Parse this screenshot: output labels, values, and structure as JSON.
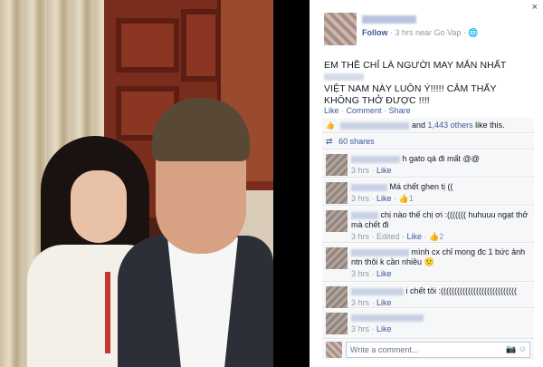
{
  "post": {
    "meta_follow": "Follow",
    "meta_time": " · 3 hrs near Go Vap · ",
    "privacy_icon": "globe-icon",
    "text_line1": "EM THỀ CHỈ LÀ NGƯỜI MAY MẮN NHẤT",
    "text_line2": "VIỆT NAM NÀY LUÔN Ý!!!!! CẢM THẤY KHÔNG THỞ ĐƯỢC !!!!",
    "actions": {
      "like": "Like",
      "comment": "Comment",
      "share": "Share"
    },
    "likes_text_and": "and",
    "likes_others": "1,443 others",
    "likes_suffix": "like this.",
    "shares_count": "60 shares",
    "close": "×"
  },
  "comments": [
    {
      "text": "h gato qá đi mất @@",
      "meta": "3 hrs · ",
      "like": "Like",
      "likes_count": ""
    },
    {
      "text": "Má chết          ghen tị       ((",
      "meta": "3 hrs · ",
      "like": "Like",
      "likes_count": "1"
    },
    {
      "text": "chị nào thế chị ơi :((((((( huhuuu          ngạt thở mà chết đi",
      "meta": "3 hrs · Edited · ",
      "like": "Like",
      "likes_count": "2"
    },
    {
      "text": "mình cx chỉ mong đc 1 bức ảnh ntn thôi k cần nhiều 🙁",
      "meta": "3 hrs · ",
      "like": "Like",
      "likes_count": ""
    },
    {
      "text": "i chết tôi :((((((((((((((((((((((((((((",
      "meta": "3 hrs · ",
      "like": "Like",
      "likes_count": ""
    },
    {
      "text": "",
      "meta": "3 hrs · ",
      "like": "Like",
      "likes_count": ""
    }
  ],
  "write_comment": {
    "placeholder": "Write a comment...",
    "icons": "📷 ☺"
  },
  "colors": {
    "link": "#3b5998",
    "muted": "#9197a3",
    "panel_bg": "#f6f7f9"
  }
}
